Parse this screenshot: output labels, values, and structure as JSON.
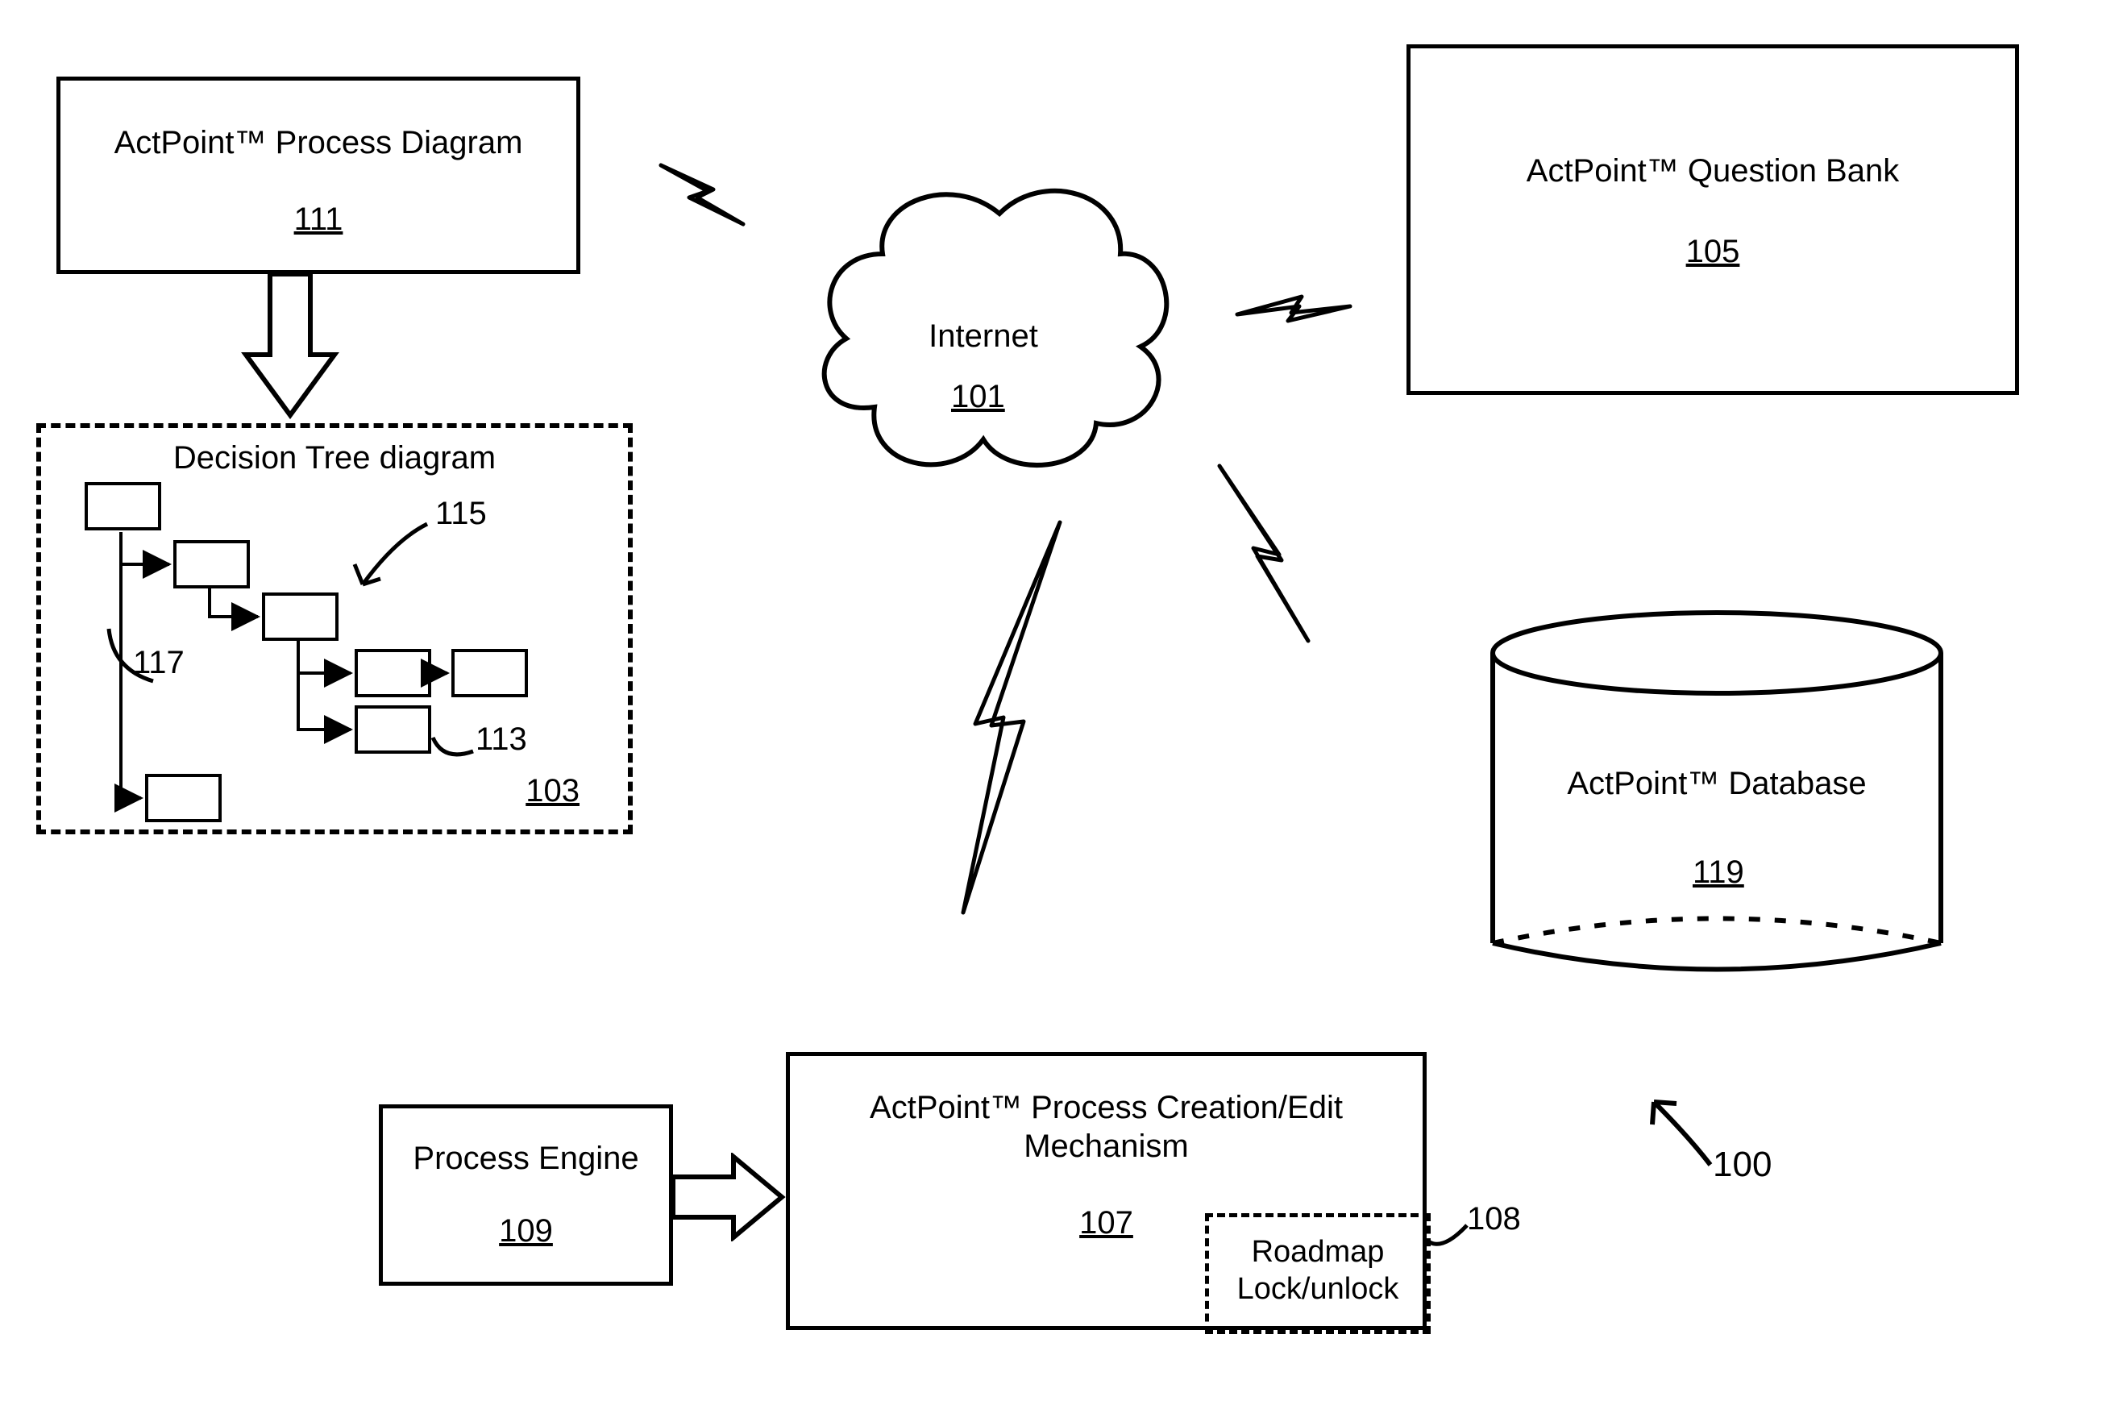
{
  "nodes": {
    "process_diagram": {
      "label": "ActPoint™ Process Diagram",
      "ref": "111"
    },
    "decision_tree": {
      "label": "Decision Tree diagram",
      "ref": "103"
    },
    "internet": {
      "label": "Internet",
      "ref": "101"
    },
    "question_bank": {
      "label": "ActPoint™ Question Bank",
      "ref": "105"
    },
    "database": {
      "label": "ActPoint™ Database",
      "ref": "119"
    },
    "process_engine": {
      "label": "Process Engine",
      "ref": "109"
    },
    "creation_mech": {
      "label": "ActPoint™ Process Creation/Edit Mechanism",
      "ref": "107"
    },
    "roadmap": {
      "label": "Roadmap Lock/unlock",
      "ref": "108"
    }
  },
  "callouts": {
    "c100": "100",
    "c113": "113",
    "c115": "115",
    "c117": "117"
  }
}
